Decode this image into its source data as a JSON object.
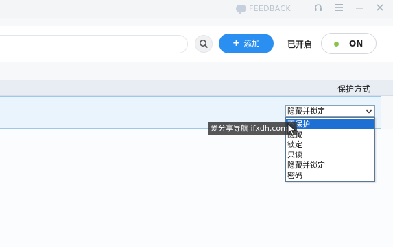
{
  "titlebar": {
    "feedback_label": "FEEDBACK",
    "icons": [
      "chat-bubble-icon",
      "headset-icon",
      "menu-icon",
      "minimize-icon",
      "close-icon"
    ]
  },
  "toolbar": {
    "search": {
      "value": "",
      "placeholder": ""
    },
    "add_label": "添加",
    "status_label": "已开启",
    "toggle_label": "ON",
    "toggle_on": true
  },
  "table": {
    "column_header": "保护方式",
    "row": {
      "protection_value": "隐藏并锁定"
    }
  },
  "dropdown": {
    "options": [
      "不保护",
      "隐藏",
      "锁定",
      "只读",
      "隐藏并锁定",
      "密码"
    ],
    "highlighted_index": 0
  },
  "overlay": {
    "watermark_text": "爱分享导航 ifxdh.com"
  },
  "colors": {
    "accent": "#2a8ff0",
    "toggle_dot": "#8bc34a",
    "selection": "#1e6fd4",
    "row_highlight": "#eaf4fd"
  }
}
